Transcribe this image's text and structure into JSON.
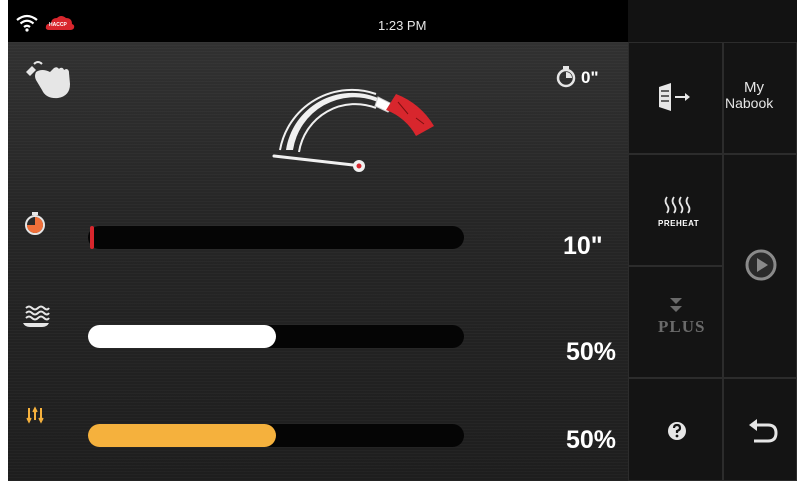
{
  "status_bar": {
    "time": "1:23 PM",
    "haccp_badge": "HACCP",
    "icons": [
      "wifi-icon",
      "haccp-cloud-icon"
    ]
  },
  "header": {
    "manual_mode_icon": "hand-touch-icon",
    "timer_icon": "stopwatch-icon",
    "timer_value": "0\"",
    "gauge_icon": "speedometer-gauge-icon"
  },
  "parameters": [
    {
      "id": "time",
      "icon": "stopwatch-icon",
      "value_text": "10\"",
      "level": 0.0,
      "fill_color": "#d8262d"
    },
    {
      "id": "humidity",
      "icon": "steam-humidity-icon",
      "value_text": "50%",
      "level": 0.5,
      "fill_color": "#ffffff"
    },
    {
      "id": "fan",
      "icon": "fan-speed-icon",
      "value_text": "50%",
      "level": 0.5,
      "fill_color": "#f5b13d"
    }
  ],
  "side_menu": {
    "door_icon": "door-exit-icon",
    "my_nabook_line1": "My",
    "my_nabook_line2": "Nabook",
    "preheat_label": "PREHEAT",
    "preheat_icon": "heat-waves-icon",
    "plus_label": "PLUS",
    "plus_icon": "chevron-down-double-icon",
    "start_icon": "play-circle-icon",
    "help_icon": "question-circle-icon",
    "back_icon": "back-arrow-icon"
  },
  "colors": {
    "accent_red": "#d8262d",
    "fan_orange": "#f5b13d",
    "time_icon_orange": "#f0703a"
  }
}
